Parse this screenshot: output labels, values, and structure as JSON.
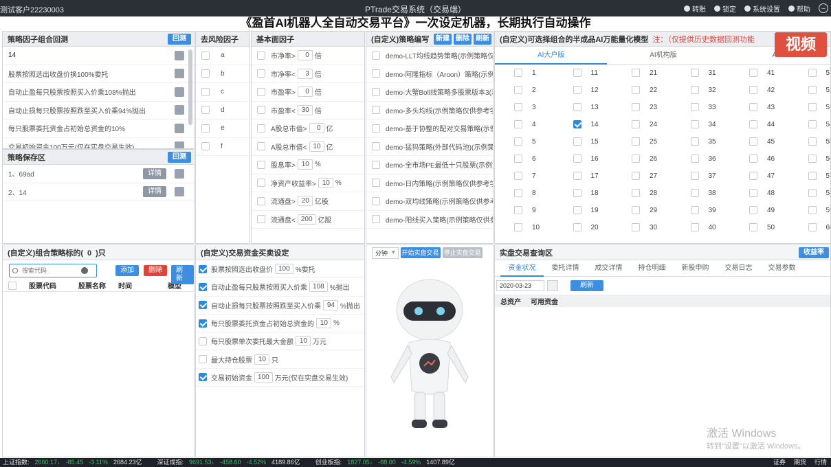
{
  "titlebar": {
    "account": "测试客户22230003",
    "title": "PTrade交易系统（交易端）",
    "menu": [
      "转账",
      "锁定",
      "系统设置",
      "帮助"
    ]
  },
  "headline": "《盈首AI机器人全自动交易平台》一次设定机器，长期执行自动操作",
  "factor_panel": {
    "title": "策略因子组合回测",
    "button": "回测",
    "items": [
      "14",
      "股票按照选出收盘价换100%委托",
      "自动止盈每只股票按照买入价乘108%抛出",
      "自动止损每只股票按照跌至买入价乘94%抛出",
      "每只股票委托资金占初始总资金的10%",
      "交易初始资金100万元(仅在实盘交易生效)"
    ]
  },
  "save_panel": {
    "title": "策略保存区",
    "button": "回测",
    "detail": "详情",
    "items": [
      "1、69ad",
      "2、14"
    ]
  },
  "risk_panel": {
    "title": "去风险因子",
    "items": [
      "a",
      "b",
      "c",
      "d",
      "e",
      "f"
    ]
  },
  "fund_panel": {
    "title": "基本面因子",
    "items": [
      {
        "pre": "市净率>",
        "val": "0",
        "unit": "倍"
      },
      {
        "pre": "市净率<",
        "val": "3",
        "unit": "倍"
      },
      {
        "pre": "市盈率>",
        "val": "0",
        "unit": "倍"
      },
      {
        "pre": "市盈率<",
        "val": "30",
        "unit": "倍"
      },
      {
        "pre": "A股总市值>",
        "val": "0",
        "unit": "亿"
      },
      {
        "pre": "A股总市值<",
        "val": "10",
        "unit": "亿"
      },
      {
        "pre": "股息率>",
        "val": "10",
        "unit": "%"
      },
      {
        "pre": "净资产收益率>",
        "val": "10",
        "unit": "%"
      },
      {
        "pre": "流通盘>",
        "val": "20",
        "unit": "亿股"
      },
      {
        "pre": "流通盘<",
        "val": "200",
        "unit": "亿股"
      }
    ]
  },
  "strategy_panel": {
    "title": "(自定义)策略编写",
    "btn_new": "新建",
    "btn_del": "删除",
    "btn_refresh": "刷新",
    "items": [
      "demo-LLT均线趋势策略(示例策略仅供",
      "demo-阿隆指标（Aroon）策略(示例",
      "demo-大蟹Boll线策略多股票版本3(示",
      "demo-多头均线(示例策略仅供参考学",
      "demo-基于协整的配对交易策略(示例",
      "demo-猛犸策略(外部代码池)(示例策略",
      "demo-全市场PE最低十只股票(示例策",
      "demo-日内策略(示例策略仅供参考学",
      "demo-双均线策略(示例策略仅供参考",
      "demo-阳线买入策略(示例策略仅供参"
    ]
  },
  "ai_panel": {
    "title": "(自定义)可选择组合的半成品AI万能量化模型",
    "note": "注：（仅提供历史数据回测功能",
    "tabs": [
      "AI大户版",
      "AI机构版",
      "AI"
    ],
    "checked": 14
  },
  "combo_panel": {
    "title": "(自定义)组合策略标的(",
    "count": "0",
    "title_end": ")只",
    "placeholder": "搜索代码",
    "btn_add": "添加",
    "btn_del": "删除",
    "btn_refresh": "刷新",
    "cols": [
      "股票代码",
      "股票名称",
      "时间",
      "模型"
    ]
  },
  "trade_panel": {
    "title": "(自定义)交易资金买卖设定",
    "items": [
      {
        "on": true,
        "pre": "股票按照选出收盘价",
        "val": "100",
        "post": "%委托"
      },
      {
        "on": true,
        "pre": "自动止盈每只股票按照买入价乘",
        "val": "108",
        "post": "%抛出"
      },
      {
        "on": true,
        "pre": "自动止损每只股票按照跌至买入价乘",
        "val": "94",
        "post": "%抛出"
      },
      {
        "on": true,
        "pre": "每只股票委托资金占初始总资金的",
        "val": "10",
        "post": "%"
      },
      {
        "on": false,
        "pre": "每只股票单次委托最大金额",
        "val": "10",
        "post": "万元"
      },
      {
        "on": false,
        "pre": "最大持仓股票",
        "val": "10",
        "post": "只"
      },
      {
        "on": true,
        "pre": "交易初始资金",
        "val": "100",
        "post": "万元(仅在实盘交易生效)"
      }
    ]
  },
  "robot_panel": {
    "select": "分钟",
    "btn_start": "开始实盘交易",
    "btn_stop": "停止实盘交易"
  },
  "query_panel": {
    "title": "实盘交易查询区",
    "btn": "收益率",
    "tabs": [
      "资金状况",
      "委托详情",
      "成交详情",
      "持仓明细",
      "新股申购",
      "交易日志",
      "交易参数"
    ],
    "date": "2020-03-23",
    "btn_refresh": "刷新",
    "cols": [
      "总资产",
      "可用资金"
    ]
  },
  "watermark": {
    "line1": "激活 Windows",
    "line2": "转到\"设置\"以激活 Windows。",
    "logo": "视频"
  },
  "statusbar": {
    "items": [
      {
        "label": "上证指数:",
        "v": "2660.17↓",
        "c": "-85.45",
        "p": "-3.11%",
        "a": "2684.23亿"
      },
      {
        "label": "深证成指:",
        "v": "9691.53↓",
        "c": "-458.60",
        "p": "-4.52%",
        "a": "4189.86亿"
      },
      {
        "label": "创业板指:",
        "v": "1827.05↓",
        "c": "-88.00",
        "p": "-4.59%",
        "a": "1407.89亿"
      }
    ],
    "right": [
      "证券",
      "期货",
      "行情"
    ]
  }
}
